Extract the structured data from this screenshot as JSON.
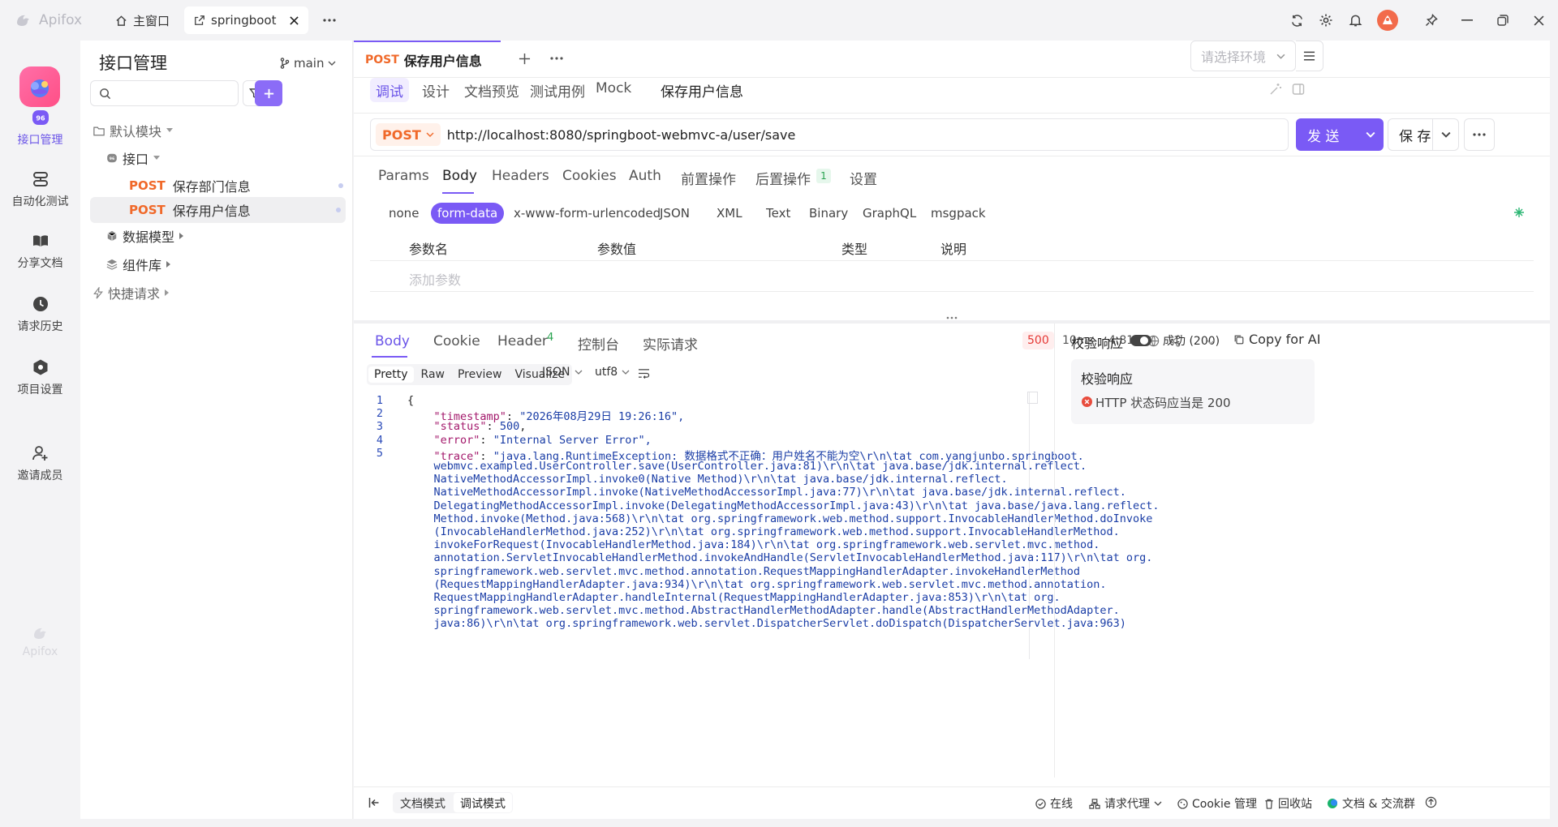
{
  "titlebar": {
    "brand": "Apifox",
    "tabs": [
      {
        "label": "主窗口"
      },
      {
        "label": "springboot"
      }
    ]
  },
  "rail": {
    "items": [
      {
        "label": "接口管理"
      },
      {
        "label": "自动化测试"
      },
      {
        "label": "分享文档"
      },
      {
        "label": "请求历史"
      },
      {
        "label": "项目设置"
      },
      {
        "label": "邀请成员"
      }
    ],
    "bottom_brand": "Apifox"
  },
  "sidebar": {
    "title": "接口管理",
    "branch": "main",
    "search_placeholder": "",
    "tree": {
      "default_module": "默认模块",
      "api_folder": "接口",
      "apis": [
        {
          "method": "POST",
          "name": "保存部门信息"
        },
        {
          "method": "POST",
          "name": "保存用户信息"
        }
      ],
      "data_model": "数据模型",
      "components": "组件库",
      "quick_request": "快捷请求"
    }
  },
  "main": {
    "tab": {
      "method": "POST",
      "title": "保存用户信息"
    },
    "env_placeholder": "请选择环境",
    "mode_tabs": [
      "调试",
      "设计",
      "文档预览",
      "测试用例",
      "Mock"
    ],
    "api_name": "保存用户信息",
    "request": {
      "method": "POST",
      "url": "http://localhost:8080/springboot-webmvc-a/user/save",
      "send_label": "发 送",
      "save_label": "保 存"
    },
    "request_tabs": [
      "Params",
      "Body",
      "Headers",
      "Cookies",
      "Auth",
      "前置操作",
      "后置操作",
      "设置"
    ],
    "post_ops_count": "1",
    "body_types": [
      "none",
      "form-data",
      "x-www-form-urlencoded",
      "JSON",
      "XML",
      "Text",
      "Binary",
      "GraphQL",
      "msgpack"
    ],
    "params_table": {
      "headers": [
        "参数名",
        "参数值",
        "类型",
        "说明"
      ],
      "add_placeholder": "添加参数"
    },
    "response": {
      "tabs": [
        "Body",
        "Cookie",
        "Header",
        "控制台",
        "实际请求"
      ],
      "header_count": "4",
      "status_code": "500",
      "time": "10ms",
      "size": "4.81K",
      "view_tabs": [
        "Pretty",
        "Raw",
        "Preview",
        "Visualize"
      ],
      "format": "JSON",
      "encoding": "utf8",
      "line_numbers": [
        "1",
        "2",
        "3",
        "4",
        "5"
      ],
      "code_lines": [
        "{",
        "    \"timestamp\": \"2026年08月29日 19:26:16\",",
        "    \"status\": 500,",
        "    \"error\": \"Internal Server Error\",",
        "    \"trace\": \"java.lang.RuntimeException: 数据格式不正确：用户姓名不能为空\\r\\n\\tat com.yangjunbo.springboot.",
        "    webmvc.exampled.UserController.save(UserController.java:81)\\r\\n\\tat java.base/jdk.internal.reflect.",
        "    NativeMethodAccessorImpl.invoke0(Native Method)\\r\\n\\tat java.base/jdk.internal.reflect.",
        "    NativeMethodAccessorImpl.invoke(NativeMethodAccessorImpl.java:77)\\r\\n\\tat java.base/jdk.internal.reflect.",
        "    DelegatingMethodAccessorImpl.invoke(DelegatingMethodAccessorImpl.java:43)\\r\\n\\tat java.base/java.lang.reflect.",
        "    Method.invoke(Method.java:568)\\r\\n\\tat org.springframework.web.method.support.InvocableHandlerMethod.doInvoke",
        "    (InvocableHandlerMethod.java:252)\\r\\n\\tat org.springframework.web.method.support.InvocableHandlerMethod.",
        "    invokeForRequest(InvocableHandlerMethod.java:184)\\r\\n\\tat org.springframework.web.servlet.mvc.method.",
        "    annotation.ServletInvocableHandlerMethod.invokeAndHandle(ServletInvocableHandlerMethod.java:117)\\r\\n\\tat org.",
        "    springframework.web.servlet.mvc.method.annotation.RequestMappingHandlerAdapter.invokeHandlerMethod",
        "    (RequestMappingHandlerAdapter.java:934)\\r\\n\\tat org.springframework.web.servlet.mvc.method.annotation.",
        "    RequestMappingHandlerAdapter.handleInternal(RequestMappingHandlerAdapter.java:853)\\r\\n\\tat org.",
        "    springframework.web.servlet.mvc.method.AbstractHandlerMethodAdapter.handle(AbstractHandlerMethodAdapter.",
        "    java:86)\\r\\n\\tat org.springframework.web.servlet.DispatcherServlet.doDispatch(DispatcherServlet.java:963)"
      ]
    },
    "validation": {
      "label": "校验响应",
      "status_select": "成功 (200)",
      "copy_ai": "Copy for AI",
      "card_title": "校验响应",
      "rule": "HTTP 状态码应当是 200"
    },
    "statusbar": {
      "doc_mode": "文档模式",
      "debug_mode": "调试模式",
      "online": "在线",
      "proxy": "请求代理",
      "cookie": "Cookie 管理",
      "recycle": "回收站",
      "community": "文档 & 交流群"
    }
  },
  "colors": {
    "accent": "#7a5af5",
    "post": "#f0692a",
    "error": "#e53935"
  }
}
